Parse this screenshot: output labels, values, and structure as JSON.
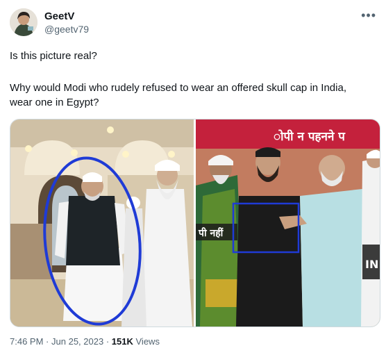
{
  "tweet": {
    "display_name": "GeetV",
    "handle": "@geetv79",
    "more_icon": "more-horizontal-icon",
    "paragraph_1": "Is this picture real?",
    "paragraph_2": "Why would Modi who rudely refused to wear an offered skull cap in India, wear one in Egypt?",
    "media": {
      "left_overlay_text": "",
      "right_top_caption": "ोपी न पहनने प",
      "right_side_caption": "पी नहीं",
      "right_edge_caption": "IN"
    },
    "time": "7:46 PM",
    "separator": "·",
    "date": "Jun 25, 2023",
    "views_count": "151K",
    "views_label": "Views"
  },
  "colors": {
    "text_primary": "#0f1419",
    "text_secondary": "#536471",
    "highlight_circle": "#1f3bd6",
    "banner_red": "#c4213c"
  }
}
